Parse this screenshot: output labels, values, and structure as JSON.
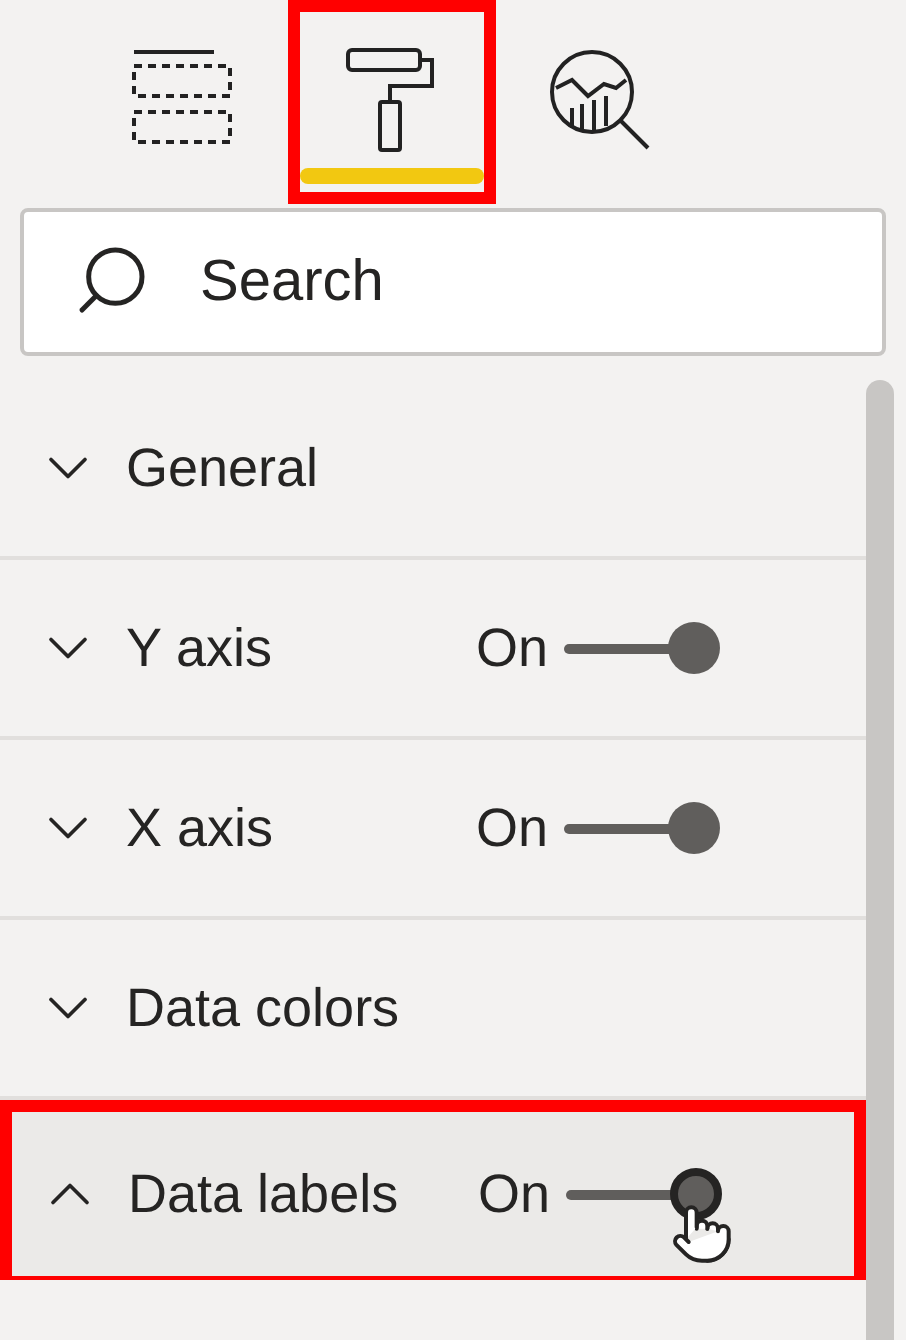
{
  "tabs": [
    {
      "kind": "fields",
      "selected": false,
      "highlighted": false
    },
    {
      "kind": "format",
      "selected": true,
      "highlighted": true
    },
    {
      "kind": "analytics",
      "selected": false,
      "highlighted": false
    }
  ],
  "search": {
    "placeholder": "Search"
  },
  "sections": [
    {
      "label": "General",
      "expanded": false,
      "highlighted": false
    },
    {
      "label": "Y axis",
      "expanded": false,
      "highlighted": false,
      "toggle": {
        "label": "On",
        "on": true
      }
    },
    {
      "label": "X axis",
      "expanded": false,
      "highlighted": false,
      "toggle": {
        "label": "On",
        "on": true
      }
    },
    {
      "label": "Data colors",
      "expanded": false,
      "highlighted": false
    },
    {
      "label": "Data labels",
      "expanded": true,
      "highlighted": true,
      "toggle": {
        "label": "On",
        "on": true,
        "hovered": true
      }
    }
  ]
}
